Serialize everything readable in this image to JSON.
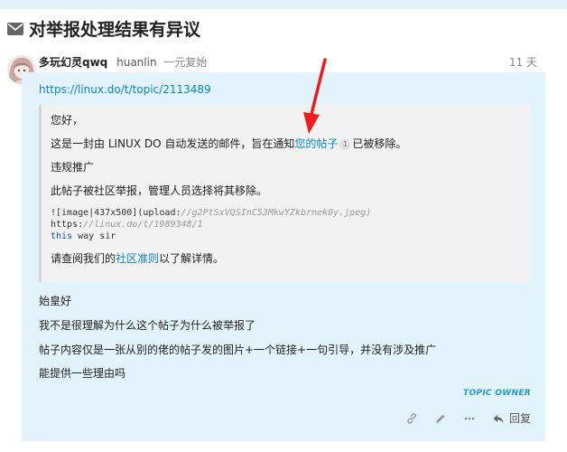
{
  "banner": {
    "text": "",
    "link": ""
  },
  "topic": {
    "title": "对举报处理结果有异议"
  },
  "post": {
    "username": "多玩幻灵qwq",
    "handle": "huanlin",
    "user_title": "一元复始",
    "age": "11 天",
    "topic_link": "https://linux.do/t/topic/2113489",
    "quote": {
      "greeting": "您好，",
      "line1_before": "这是一封由 LINUX DO 自动发送的邮件，旨在通知",
      "line1_link": "您的帖子",
      "line1_badge": "1",
      "line1_after": "已被移除。",
      "reason": "违规推广",
      "line3": "此帖子被社区举报，管理人员选择将其移除。",
      "code_l1_a": "![image|437x500](upload:",
      "code_l1_b": "//g2PtSxVQSInC53MkwYZkbrnek0y.jpeg)",
      "code_l2_a": "https:",
      "code_l2_b": "//linux.do/t/1989348/1",
      "code_l3_a": "this",
      "code_l3_b": " way sir",
      "footer_before": "请查阅我们的",
      "footer_link": "社区准则",
      "footer_after": "以了解详情。"
    },
    "paragraphs": [
      "始皇好",
      "我不是很理解为什么这个帖子为什么被举报了",
      "帖子内容仅是一张从别的佬的帖子发的图片+一个链接+一句引导，并没有涉及推广",
      "能提供一些理由吗"
    ],
    "owner_badge": "TOPIC OWNER",
    "reply_label": "回复"
  },
  "colors": {
    "post_bg": "#e3f3fc",
    "link": "#0a87c8",
    "owner": "#1e9bd7",
    "arrow": "#ee1c1c"
  },
  "icons": [
    "envelope-icon",
    "link-icon",
    "pencil-icon",
    "ellipsis-icon",
    "reply-icon"
  ]
}
